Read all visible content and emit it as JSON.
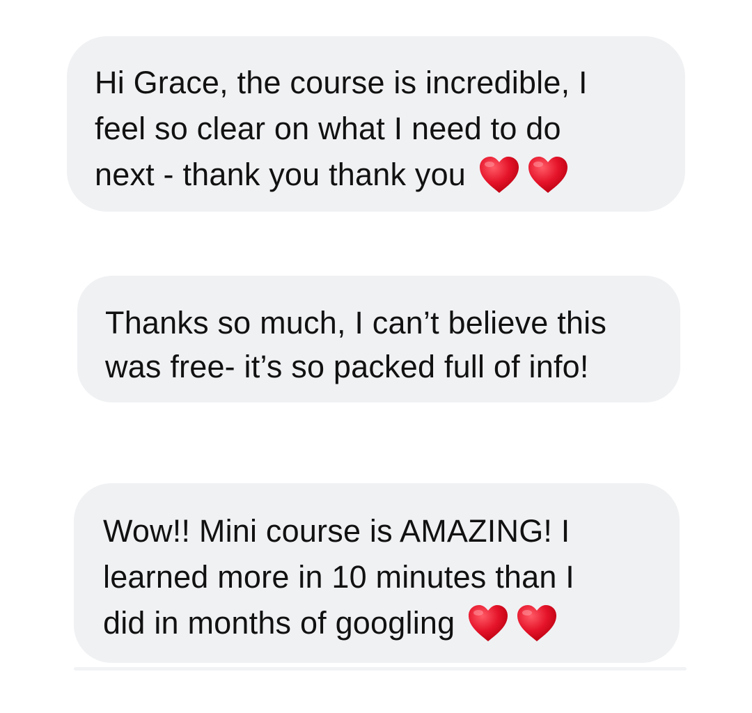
{
  "messages": [
    {
      "lines": [
        "Hi Grace, the course is incredible, I",
        "feel so clear on what I need to do",
        "next - thank you thank you"
      ],
      "emojis": [
        "red-heart",
        "red-heart"
      ]
    },
    {
      "lines": [
        "Thanks so much, I can’t believe this",
        "was free- it’s so packed full of info!"
      ],
      "emojis": []
    },
    {
      "lines": [
        "Wow!! Mini course is AMAZING! I",
        "learned more in 10 minutes than I",
        "did in months of googling"
      ],
      "emojis": [
        "red-heart",
        "red-heart"
      ]
    }
  ],
  "colors": {
    "bubble_background": "#f0f1f3",
    "text": "#111111",
    "heart": "#e5142a"
  }
}
